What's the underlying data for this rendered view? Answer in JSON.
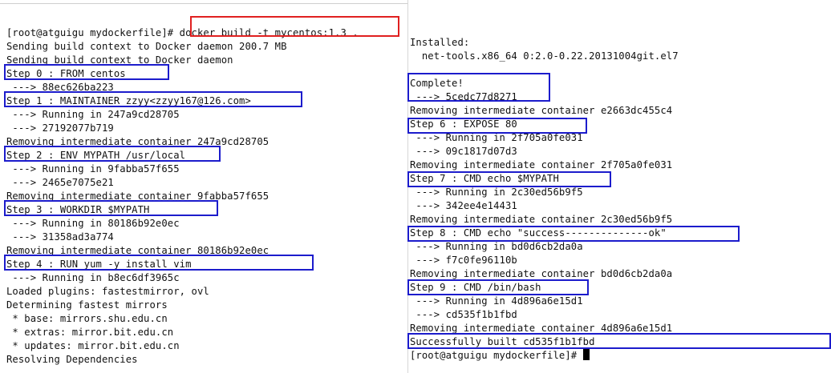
{
  "left_terminal": {
    "lines": [
      "[root@atguigu mydockerfile]# docker build -t mycentos:1.3 .",
      "Sending build context to Docker daemon 200.7 MB",
      "Sending build context to Docker daemon",
      "Step 0 : FROM centos",
      " ---> 88ec626ba223",
      "Step 1 : MAINTAINER zzyy<zzyy167@126.com>",
      " ---> Running in 247a9cd28705",
      " ---> 27192077b719",
      "Removing intermediate container 247a9cd28705",
      "Step 2 : ENV MYPATH /usr/local",
      " ---> Running in 9fabba57f655",
      " ---> 2465e7075e21",
      "Removing intermediate container 9fabba57f655",
      "Step 3 : WORKDIR $MYPATH",
      " ---> Running in 80186b92e0ec",
      " ---> 31358ad3a774",
      "Removing intermediate container 80186b92e0ec",
      "Step 4 : RUN yum -y install vim",
      " ---> Running in b8ec6df3965c",
      "Loaded plugins: fastestmirror, ovl",
      "Determining fastest mirrors",
      " * base: mirrors.shu.edu.cn",
      " * extras: mirror.bit.edu.cn",
      " * updates: mirror.bit.edu.cn",
      "Resolving Dependencies"
    ]
  },
  "right_terminal": {
    "lines": [
      "Installed:",
      "  net-tools.x86_64 0:2.0-0.22.20131004git.el7",
      "",
      "Complete!",
      " ---> 5cedc77d8271",
      "Removing intermediate container e2663dc455c4",
      "Step 6 : EXPOSE 80",
      " ---> Running in 2f705a0fe031",
      " ---> 09c1817d07d3",
      "Removing intermediate container 2f705a0fe031",
      "Step 7 : CMD echo $MYPATH",
      " ---> Running in 2c30ed56b9f5",
      " ---> 342ee4e14431",
      "Removing intermediate container 2c30ed56b9f5",
      "Step 8 : CMD echo \"success--------------ok\"",
      " ---> Running in bd0d6cb2da0a",
      " ---> f7c0fe96110b",
      "Removing intermediate container bd0d6cb2da0a",
      "Step 9 : CMD /bin/bash",
      " ---> Running in 4d896a6e15d1",
      " ---> cd535f1b1fbd",
      "Removing intermediate container 4d896a6e15d1",
      "Successfully built cd535f1b1fbd",
      "[root@atguigu mydockerfile]# "
    ]
  },
  "colors": {
    "highlight_blue": "#1c1ccc",
    "highlight_red": "#e02020",
    "text": "#111111",
    "background": "#ffffff"
  }
}
